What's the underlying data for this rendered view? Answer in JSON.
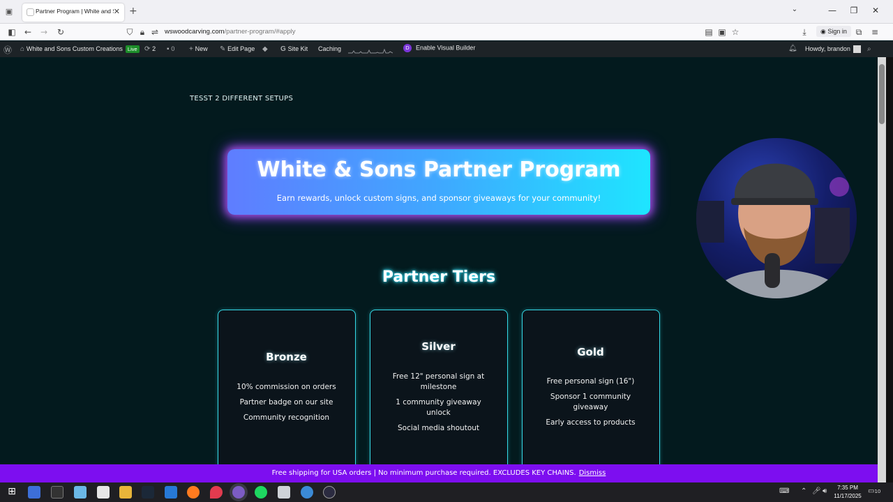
{
  "browser": {
    "tab_title": "Partner Program | White and So",
    "tab_close": "✕",
    "new_tab": "+",
    "url_host": "wswoodcarving.com",
    "url_path": "/partner-program/#apply",
    "sign_in": "Sign in",
    "window_controls": {
      "minimize": "—",
      "restore": "❐",
      "close": "✕"
    }
  },
  "admin_bar": {
    "site_name": "White and Sons Custom Creations",
    "live_badge": "Live",
    "updates_count": "2",
    "comments_count": "0",
    "new_label": "New",
    "edit_page": "Edit Page",
    "site_kit": "Site Kit",
    "caching": "Caching",
    "visual_builder": "Enable Visual Builder",
    "greeting": "Howdy, brandon"
  },
  "page": {
    "test_label": "TESST 2 DIFFERENT SETUPS",
    "hero_title": "White & Sons Partner Program",
    "hero_subtitle": "Earn rewards, unlock custom signs, and sponsor giveaways for your community!",
    "tiers_title": "Partner Tiers",
    "tiers": [
      {
        "name": "Bronze",
        "perks": [
          "10% commission on orders",
          "Partner badge on our site",
          "Community recognition"
        ]
      },
      {
        "name": "Silver",
        "perks": [
          "Free 12\" personal sign at milestone",
          "1 community giveaway unlock",
          "Social media shoutout"
        ]
      },
      {
        "name": "Gold",
        "perks": [
          "Free personal sign (16\")",
          "Sponsor 1 community giveaway",
          "Early access to products"
        ]
      }
    ]
  },
  "promo": {
    "text": "Free shipping for USA orders | No minimum purchase required. EXCLUDES KEY CHAINS.",
    "dismiss": "Dismiss"
  },
  "taskbar": {
    "time": "7:35 PM",
    "date": "11/17/2025",
    "notification_count": "10"
  },
  "colors": {
    "page_bg": "#031a1e",
    "accent_cyan": "#35d9e6",
    "promo_purple": "#7d0ef0",
    "admin_bar": "#1d2327"
  }
}
